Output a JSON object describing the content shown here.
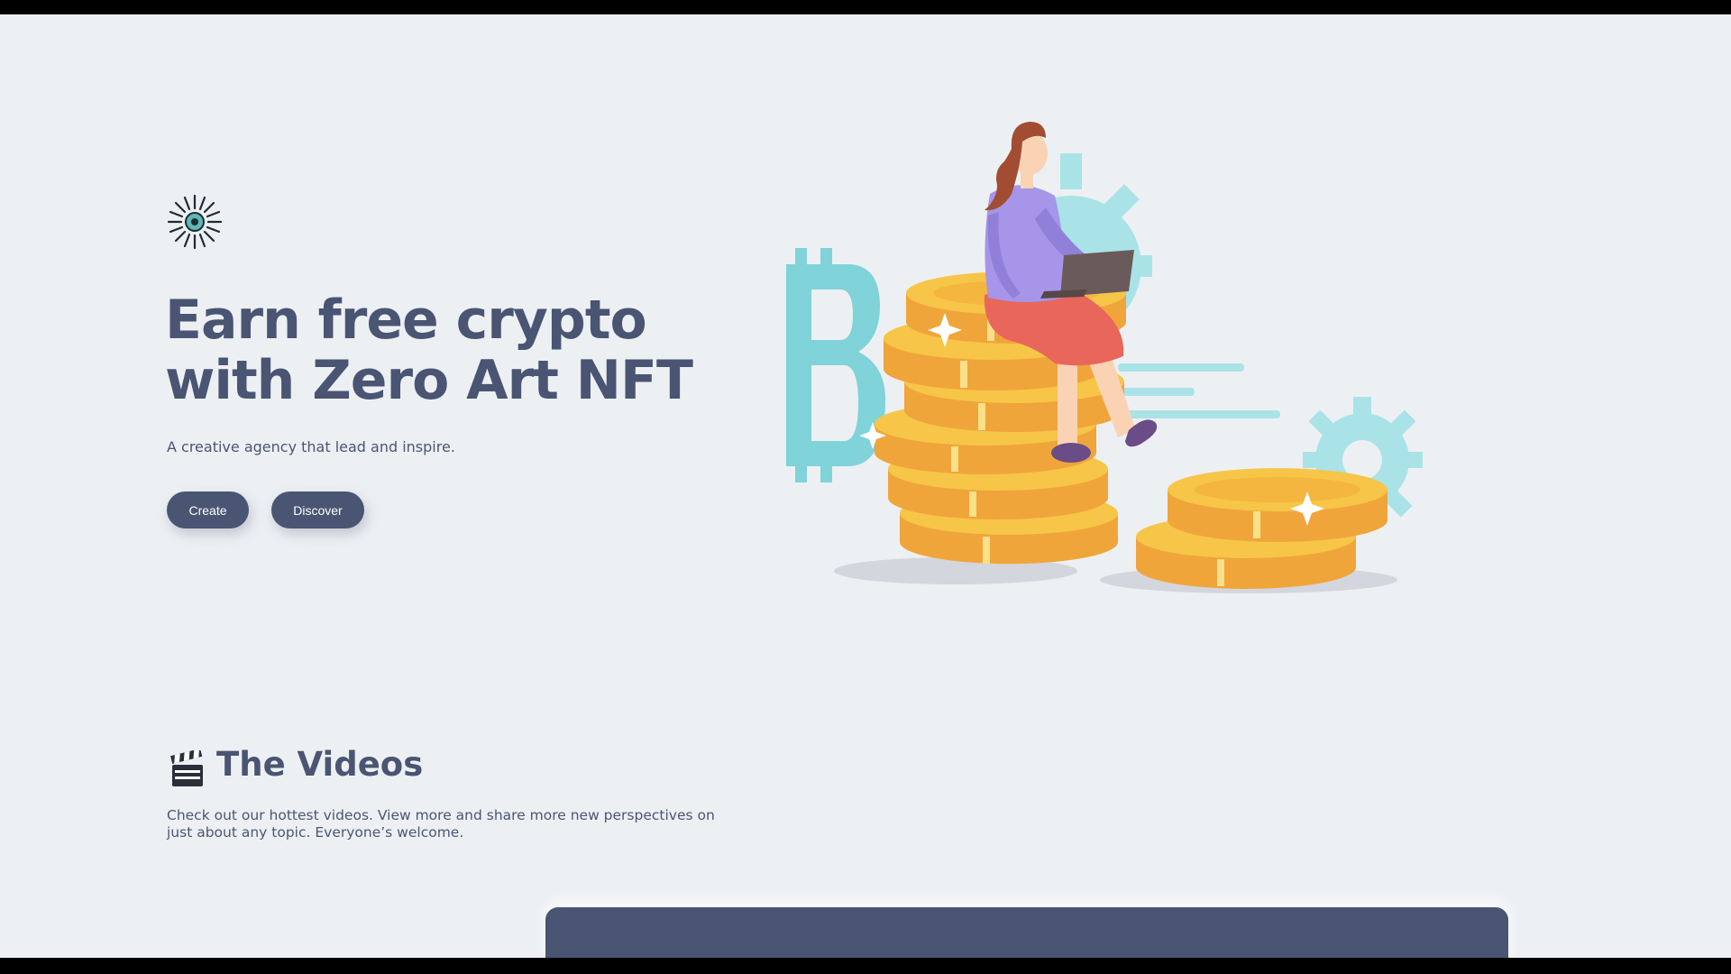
{
  "hero": {
    "logo_icon": "starburst-logo-icon",
    "title_line1": "Earn free crypto",
    "title_line2": "with Zero Art NFT",
    "subtitle": "A creative agency that lead and inspire.",
    "buttons": {
      "create_label": "Create",
      "discover_label": "Discover"
    },
    "illustration": "woman-with-laptop-on-coin-stacks"
  },
  "videos": {
    "icon": "clapperboard-icon",
    "title": "The Videos",
    "description": "Check out our hottest videos. View more and share more new perspectives on just about any topic. Everyone’s welcome."
  },
  "colors": {
    "background": "#edf0f3",
    "primary": "#4a5573",
    "accent_teal": "#7fd3d9",
    "coin_gold": "#f7c548",
    "coin_orange": "#f0a53a"
  }
}
